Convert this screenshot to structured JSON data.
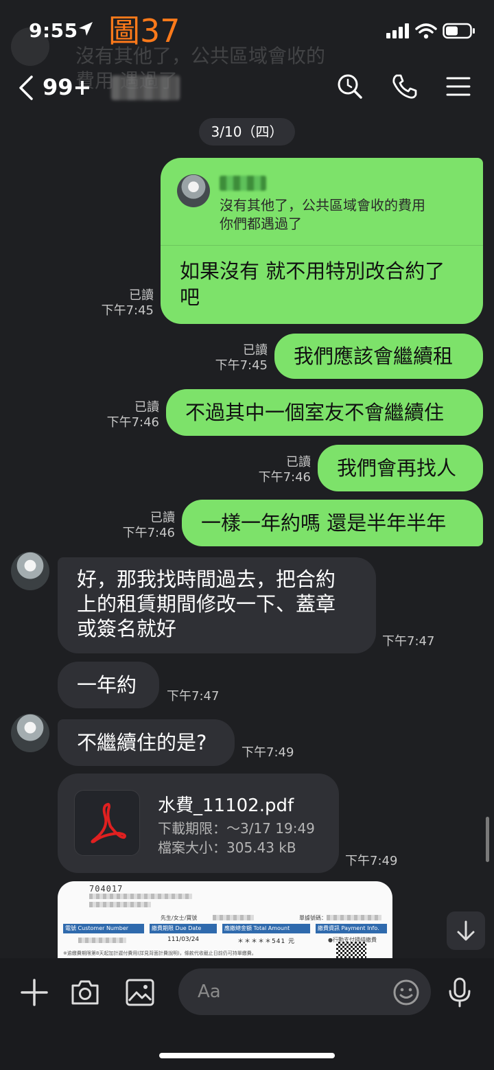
{
  "status": {
    "time": "9:55",
    "figure_label": "圖37"
  },
  "background_ghost": {
    "line1": "沒有其他了，公共區域會收的",
    "line2": "費用       遇過了"
  },
  "header": {
    "unread_count": "99+"
  },
  "date_divider": "3/10（四）",
  "reply_bubble": {
    "quoted_text_line1": "沒有其他了，公共區域會收的費用",
    "quoted_text_line2": "你們都遇過了",
    "text_line1": "如果沒有 就不用特別改合約了",
    "text_line2": "吧",
    "read": "已讀",
    "time": "下午7:45"
  },
  "sent_messages": [
    {
      "text": "我們應該會繼續租",
      "read": "已讀",
      "time": "下午7:45"
    },
    {
      "text": "不過其中一個室友不會繼續住",
      "read": "已讀",
      "time": "下午7:46"
    },
    {
      "text": "我們會再找人",
      "read": "已讀",
      "time": "下午7:46"
    },
    {
      "text": "一樣一年約嗎 還是半年半年",
      "read": "已讀",
      "time": "下午7:46"
    }
  ],
  "received_messages": [
    {
      "line1": "好，那我找時間過去，把合約",
      "line2": "上的租賃期間修改一下、蓋章",
      "line3": "或簽名就好",
      "time": "下午7:47"
    },
    {
      "text": "一年約",
      "time": "下午7:47"
    },
    {
      "text": "不繼續住的是?",
      "time": "下午7:49"
    }
  ],
  "file_message": {
    "filename": "水費_11102.pdf",
    "expiry": "下載期限：～3/17 19:49",
    "size": "檔案大小：305.43 kB",
    "time": "下午7:49"
  },
  "photo_preview": {
    "doc_number": "704017",
    "salutation": "先生/女士/寶號",
    "receipt_no": "單據號碼：",
    "col1": "電號 Customer Number",
    "col2": "繳費期限 Due Date",
    "col3": "應繳總金額 Total Amount",
    "col4": "繳費資訊 Payment Info.",
    "due_date": "111/03/24",
    "amount": "＊＊＊＊＊541 元",
    "pay_note": "●行動支付掃描繳費",
    "footnote": "※逾繳費期限第8天起加計遲付費用(詳見背面計費說明)，條款代收截止日前仍可持單繳費。"
  },
  "input": {
    "placeholder": "Aa"
  },
  "colors": {
    "sent_bubble": "#7de26a",
    "received_bubble": "#2f3035",
    "background": "#1e1f22",
    "figure_label": "#ff7a1a"
  }
}
